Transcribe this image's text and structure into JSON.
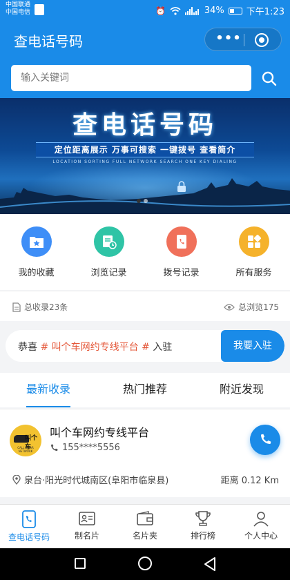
{
  "status_bar": {
    "carrier_1": "中国联通",
    "carrier_2": "中国电信",
    "battery": "34%",
    "battery_level": 0.34,
    "time": "下午1:23",
    "icons": [
      "sim-icon",
      "alarm-icon",
      "wifi-icon",
      "signal-icon",
      "battery-icon"
    ]
  },
  "header": {
    "title": "查电话号码",
    "more_label": "•••"
  },
  "search": {
    "placeholder": "输入关键词"
  },
  "banner": {
    "title": "查电话号码",
    "tagline": "定位距离展示 万事可搜索 一键拨号 查看简介",
    "subtitle": "LOCATION SORTING FULL NETWORK SEARCH ONE KEY DIALING",
    "active_slide": 1,
    "slide_count": 2
  },
  "services": [
    {
      "label": "我的收藏",
      "icon": "folder-star-icon",
      "color": "#3e8ef7"
    },
    {
      "label": "浏览记录",
      "icon": "history-icon",
      "color": "#2fc4a6"
    },
    {
      "label": "拨号记录",
      "icon": "phone-book-icon",
      "color": "#f0705a"
    },
    {
      "label": "所有服务",
      "icon": "apps-icon",
      "color": "#f5b22b"
    }
  ],
  "stats": {
    "total_listings": "总收录23条",
    "total_views": "总浏览175"
  },
  "notice": {
    "prefix": "恭喜",
    "highlight": "# 叫个车网约专线平台 #",
    "suffix": "入驻",
    "join_label": "我要入驻"
  },
  "tabs": [
    {
      "label": "最新收录",
      "active": true
    },
    {
      "label": "热门推荐",
      "active": false
    },
    {
      "label": "附近发现",
      "active": false
    }
  ],
  "listing": {
    "logo_text": "叫个车",
    "logo_tagline": "CALL A CAR NETWORK",
    "name": "叫个车网约专线平台",
    "phone": "155****5556",
    "address": "泉台·阳光时代城南区(阜阳市临泉县)",
    "distance": "距离 0.12 Km"
  },
  "bottom_nav": [
    {
      "label": "查电话号码",
      "icon": "phone-icon",
      "active": true
    },
    {
      "label": "制名片",
      "icon": "id-card-icon",
      "active": false
    },
    {
      "label": "名片夹",
      "icon": "wallet-icon",
      "active": false
    },
    {
      "label": "排行榜",
      "icon": "trophy-icon",
      "active": false
    },
    {
      "label": "个人中心",
      "icon": "user-icon",
      "active": false
    }
  ],
  "colors": {
    "primary": "#1a8be8",
    "highlight": "#e4583a"
  }
}
